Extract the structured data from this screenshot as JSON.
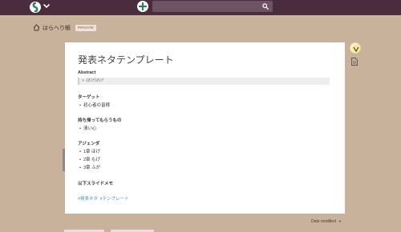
{
  "header": {
    "search": {
      "placeholder": "",
      "value": ""
    }
  },
  "breadcrumb": {
    "team_name": "はらへり帳",
    "badge": "PRIVATE"
  },
  "post": {
    "title": "発表ネタテンプレート",
    "sections": [
      {
        "label": "Abstract",
        "quote": "> ほげほげ"
      },
      {
        "label": "ターゲット",
        "items": [
          "初心者の皆様"
        ]
      },
      {
        "label": "持ち帰ってもらうもの",
        "items": [
          "清い心"
        ]
      },
      {
        "label": "アジェンダ",
        "items": [
          "1章 ほげ",
          "2章 もげ",
          "3章 ふが"
        ]
      },
      {
        "label": "以下スライドメモ"
      }
    ],
    "tags": [
      "#発表ネタ",
      "#テンプレート"
    ]
  },
  "footer": {
    "sort_label": "Date modified"
  },
  "colors": {
    "background": "#c8b29c",
    "topbar": "#4a2c3e",
    "tag_link": "#4a90c8"
  },
  "icons": [
    "team-icon",
    "chevron-down-icon",
    "plus-icon",
    "search-icon",
    "home-icon",
    "user-avatar-icon",
    "document-icon"
  ]
}
